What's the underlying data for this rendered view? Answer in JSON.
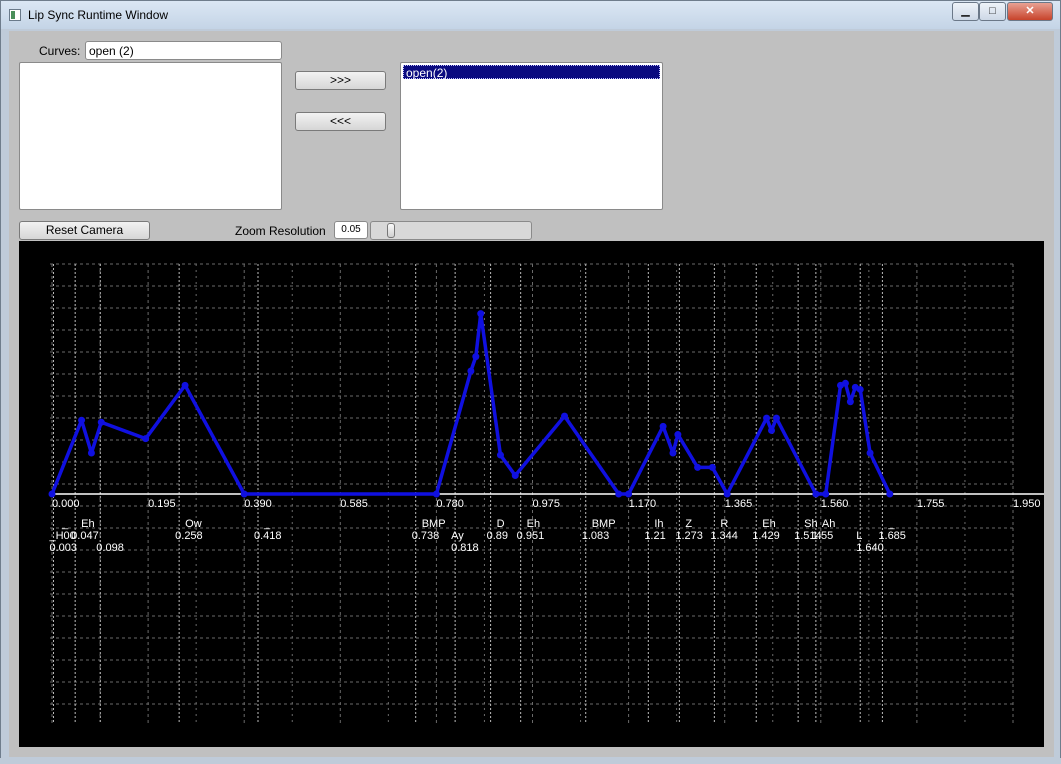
{
  "window": {
    "title": "Lip Sync Runtime Window",
    "controls": {
      "minimize": "▁",
      "maximize": "□",
      "close": "✕"
    }
  },
  "curves": {
    "label": "Curves:",
    "field_value": "open (2)",
    "selected_items": [
      "open(2)"
    ],
    "add_button": ">>>",
    "remove_button": "<<<"
  },
  "toolbar": {
    "reset_camera": "Reset Camera",
    "zoom_label": "Zoom Resolution",
    "zoom_value": "0.05",
    "slider_level": 0.05
  },
  "colors": {
    "plot_bg": "#000000",
    "curve": "#1010e0",
    "grid": "#6a6a6a",
    "axis": "#ffffff",
    "text": "#ffffff"
  },
  "chart_data": {
    "type": "line",
    "xlim": [
      0.0,
      1.95
    ],
    "x_ticks": [
      "0.000",
      "0.195",
      "0.390",
      "0.585",
      "0.780",
      "0.975",
      "1.170",
      "1.365",
      "1.560",
      "1.755",
      "1.950"
    ],
    "grid": true,
    "series": [
      {
        "name": "open(2)",
        "x": [
          0.0,
          0.06,
          0.08,
          0.1,
          0.19,
          0.27,
          0.39,
          0.78,
          0.85,
          0.86,
          0.87,
          0.91,
          0.94,
          1.04,
          1.15,
          1.17,
          1.24,
          1.26,
          1.27,
          1.31,
          1.34,
          1.37,
          1.45,
          1.46,
          1.47,
          1.55,
          1.57,
          1.6,
          1.61,
          1.62,
          1.63,
          1.64,
          1.66,
          1.7
        ],
        "y": [
          0.0,
          0.36,
          0.2,
          0.35,
          0.27,
          0.53,
          0.0,
          0.0,
          0.6,
          0.67,
          0.88,
          0.19,
          0.09,
          0.38,
          0.0,
          0.0,
          0.33,
          0.2,
          0.29,
          0.13,
          0.13,
          0.0,
          0.37,
          0.31,
          0.37,
          0.0,
          0.0,
          0.53,
          0.54,
          0.45,
          0.52,
          0.51,
          0.2,
          0.0
        ]
      }
    ],
    "phonemes": [
      {
        "label": "_",
        "time": "",
        "row": 0
      },
      {
        "label": "Eh",
        "time": "0.047",
        "row": 0
      },
      {
        "label": "Ow",
        "time": "0.258",
        "row": 0
      },
      {
        "label": "_",
        "time": "0.418",
        "row": 0
      },
      {
        "label": "BMP",
        "time": "0.738",
        "row": 0
      },
      {
        "label": "Ay",
        "time": "0.818",
        "row": 1
      },
      {
        "label": "D",
        "time": "0.89",
        "row": 0
      },
      {
        "label": "Eh",
        "time": "0.951",
        "row": 0
      },
      {
        "label": "BMP",
        "time": "1.083",
        "row": 0
      },
      {
        "label": "Ih",
        "time": "1.21",
        "row": 0
      },
      {
        "label": "Z",
        "time": "1.273",
        "row": 0
      },
      {
        "label": "R",
        "time": "1.344",
        "row": 0
      },
      {
        "label": "Eh",
        "time": "1.429",
        "row": 0
      },
      {
        "label": "Sh",
        "time": "1.514",
        "row": 0
      },
      {
        "label": "Ah",
        "time": "1.55",
        "row": 0
      },
      {
        "label": "L",
        "time": "1.640",
        "row": 1
      },
      {
        "label": "_",
        "time": "1.685",
        "row": 0
      },
      {
        "label": "_H00",
        "time": "0.003",
        "row": 1
      },
      {
        "label": "",
        "time": "0.098",
        "row": 1
      }
    ]
  }
}
